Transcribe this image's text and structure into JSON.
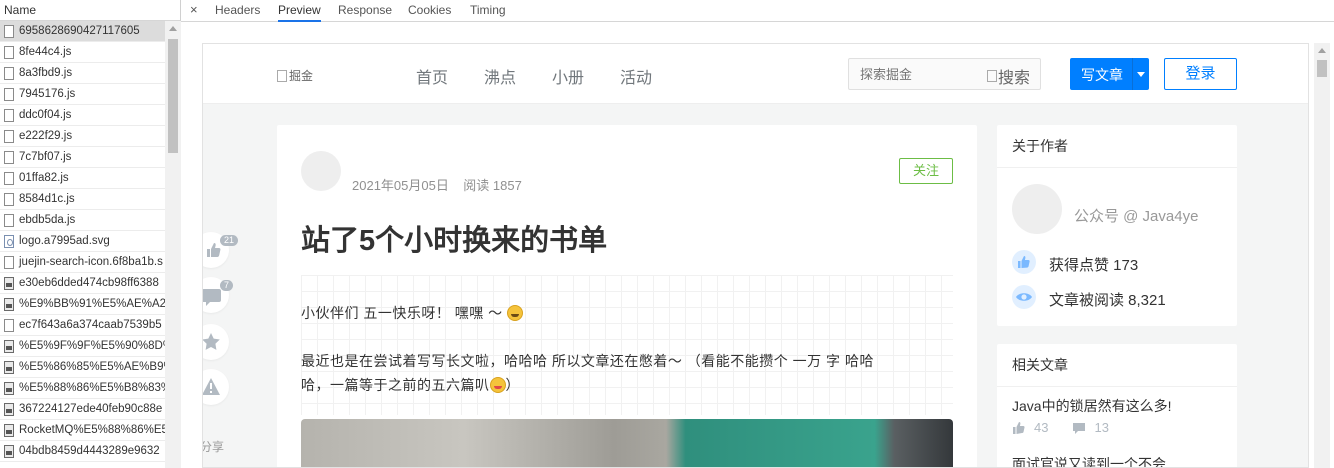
{
  "network": {
    "header": "Name",
    "rows": [
      {
        "name": "6958628690427117605",
        "type": "doc",
        "selected": true
      },
      {
        "name": "8fe44c4.js",
        "type": "doc"
      },
      {
        "name": "8a3fbd9.js",
        "type": "doc"
      },
      {
        "name": "7945176.js",
        "type": "doc"
      },
      {
        "name": "ddc0f04.js",
        "type": "doc"
      },
      {
        "name": "e222f29.js",
        "type": "doc"
      },
      {
        "name": "7c7bf07.js",
        "type": "doc"
      },
      {
        "name": "01ffa82.js",
        "type": "doc"
      },
      {
        "name": "8584d1c.js",
        "type": "doc"
      },
      {
        "name": "ebdb5da.js",
        "type": "doc"
      },
      {
        "name": "logo.a7995ad.svg",
        "type": "svg"
      },
      {
        "name": "juejin-search-icon.6f8ba1b.s",
        "type": "doc"
      },
      {
        "name": "e30eb6dded474cb98ff6388",
        "type": "img"
      },
      {
        "name": "%E9%BB%91%E5%AE%A2%",
        "type": "img"
      },
      {
        "name": "ec7f643a6a374caab7539b5",
        "type": "doc"
      },
      {
        "name": "%E5%9F%9F%E5%90%8D%",
        "type": "img"
      },
      {
        "name": "%E5%86%85%E5%AE%B9%",
        "type": "img"
      },
      {
        "name": "%E5%88%86%E5%B8%83%",
        "type": "img"
      },
      {
        "name": "367224127ede40feb90c88e",
        "type": "img"
      },
      {
        "name": "RocketMQ%E5%88%86%E5",
        "type": "img"
      },
      {
        "name": "04bdb8459d4443289e9632",
        "type": "img"
      }
    ]
  },
  "tabs": {
    "close": "×",
    "items": [
      "Headers",
      "Preview",
      "Response",
      "Cookies",
      "Timing"
    ],
    "active": "Preview",
    "accent": "#1a73e8"
  },
  "site": {
    "logo_alt": "掘金",
    "nav": [
      "首页",
      "沸点",
      "小册",
      "活动"
    ],
    "search_placeholder": "探索掘金",
    "search_button_alt": "搜索",
    "write_label": "写文章",
    "login_label": "登录",
    "brand_color": "#007fff"
  },
  "float": {
    "like_count": "21",
    "comment_count": "7",
    "share_label": "分享",
    "icons": [
      "thumb-up-icon",
      "comment-icon",
      "star-icon",
      "warning-icon"
    ]
  },
  "article": {
    "date": "2021年05月05日",
    "reads": "阅读 1857",
    "follow_label": "关注",
    "title": "站了5个小时换来的书单",
    "para1": "小伙伴们  五一快乐呀！  嘿嘿  ～ ",
    "para2_line1": "最近也是在尝试着写写长文啦，哈哈哈  所以文章还在憋着～  （看能不能攒个  一万  字  哈哈",
    "para2_line2": "哈，一篇等于之前的五六篇叭",
    "para2_end": "）"
  },
  "sidebar": {
    "about_title": "关于作者",
    "author_name": "公众号 @ Java4ye",
    "likes_label": "获得点赞 173",
    "reads_label": "文章被阅读 8,321",
    "related_title": "相关文章",
    "related": [
      {
        "title": "Java中的锁居然有这么多!",
        "likes": "43",
        "comments": "13"
      },
      {
        "title": "面试官说又读到一个不会"
      }
    ]
  }
}
